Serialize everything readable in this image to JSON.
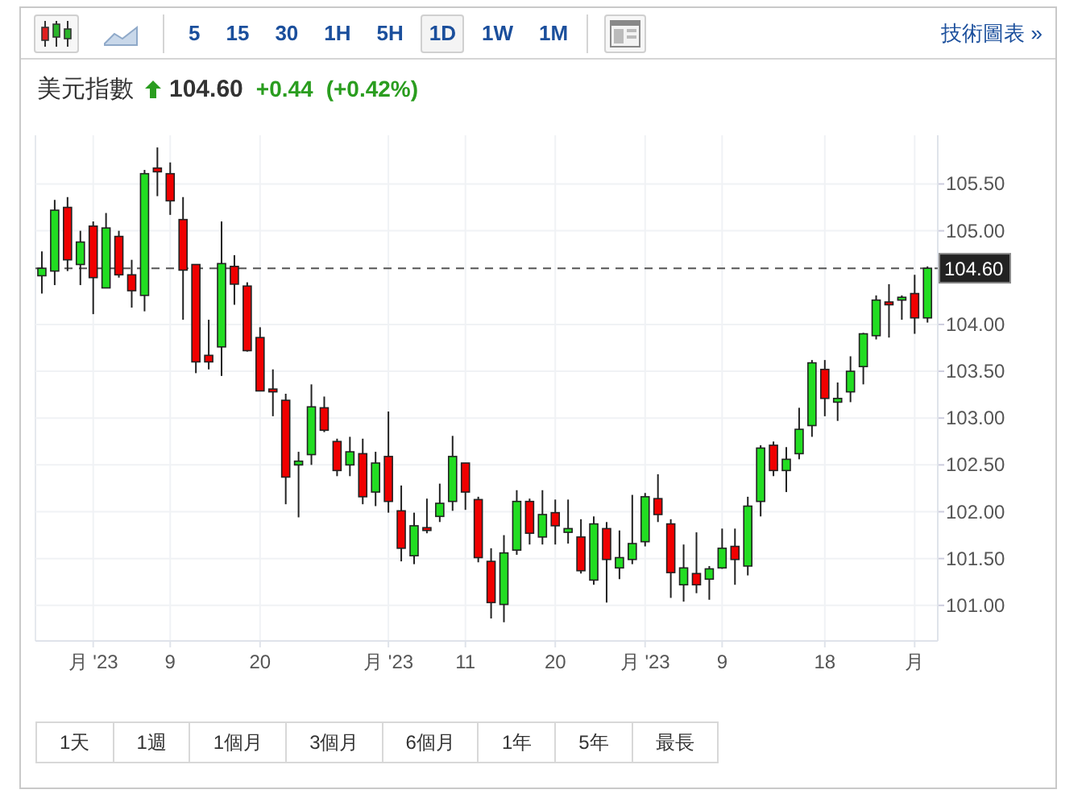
{
  "toolbar": {
    "chart_types": [
      {
        "kind": "candlestick",
        "selected": true
      },
      {
        "kind": "area",
        "selected": false
      }
    ],
    "intervals": [
      {
        "label": "5",
        "selected": false
      },
      {
        "label": "15",
        "selected": false
      },
      {
        "label": "30",
        "selected": false
      },
      {
        "label": "1H",
        "selected": false
      },
      {
        "label": "5H",
        "selected": false
      },
      {
        "label": "1D",
        "selected": true
      },
      {
        "label": "1W",
        "selected": false
      },
      {
        "label": "1M",
        "selected": false
      }
    ],
    "link": "技術圖表 »"
  },
  "quote": {
    "name": "美元指數",
    "up": true,
    "price": "104.60",
    "change": "+0.44",
    "change_percent": "(+0.42%)"
  },
  "chart": {
    "chart_data": {
      "type": "candlestick",
      "grid": true,
      "ylim": [
        100.62,
        106.02
      ],
      "yticks": [
        {
          "value": 105.5,
          "label": "105.50"
        },
        {
          "value": 105,
          "label": "105.00"
        },
        {
          "value": 104,
          "label": "104.00"
        },
        {
          "value": 103.5,
          "label": "103.50"
        },
        {
          "value": 103,
          "label": "103.00"
        },
        {
          "value": 102.5,
          "label": "102.50"
        },
        {
          "value": 102,
          "label": "102.00"
        },
        {
          "value": 101.5,
          "label": "101.50"
        },
        {
          "value": 101,
          "label": "101.00"
        }
      ],
      "categories": [
        null,
        null,
        null,
        null,
        "月 '23",
        null,
        null,
        null,
        null,
        null,
        "9",
        null,
        null,
        null,
        null,
        null,
        null,
        "20",
        null,
        null,
        null,
        null,
        null,
        null,
        null,
        null,
        null,
        "月 '23",
        null,
        null,
        null,
        null,
        null,
        "11",
        null,
        null,
        null,
        null,
        null,
        null,
        "20",
        null,
        null,
        null,
        null,
        null,
        null,
        "月 '23",
        null,
        null,
        null,
        null,
        null,
        "9",
        null,
        null,
        null,
        null,
        null,
        null,
        null,
        "18",
        null,
        null,
        null,
        null,
        null,
        null,
        "月",
        null
      ],
      "ohlc": [
        [
          104.52,
          104.78,
          104.33,
          104.6
        ],
        [
          104.57,
          105.33,
          104.42,
          105.22
        ],
        [
          105.25,
          105.36,
          104.57,
          104.69
        ],
        [
          104.64,
          105.0,
          104.42,
          104.88
        ],
        [
          105.05,
          105.1,
          104.11,
          104.5
        ],
        [
          104.39,
          105.19,
          104.39,
          105.03
        ],
        [
          104.94,
          105.0,
          104.5,
          104.53
        ],
        [
          104.53,
          104.69,
          104.18,
          104.36
        ],
        [
          104.31,
          105.65,
          104.14,
          105.61
        ],
        [
          105.67,
          105.89,
          105.37,
          105.63
        ],
        [
          105.61,
          105.73,
          105.17,
          105.32
        ],
        [
          105.12,
          105.36,
          104.05,
          104.58
        ],
        [
          104.64,
          104.64,
          103.48,
          103.6
        ],
        [
          103.67,
          104.05,
          103.52,
          103.6
        ],
        [
          103.76,
          105.1,
          103.45,
          104.65
        ],
        [
          104.62,
          104.74,
          104.21,
          104.43
        ],
        [
          104.41,
          104.45,
          103.71,
          103.72
        ],
        [
          103.86,
          103.97,
          103.29,
          103.29
        ],
        [
          103.31,
          103.52,
          103.02,
          103.28
        ],
        [
          103.19,
          103.26,
          102.08,
          102.37
        ],
        [
          102.5,
          102.64,
          101.94,
          102.54
        ],
        [
          102.61,
          103.36,
          102.5,
          103.12
        ],
        [
          103.11,
          103.23,
          102.85,
          102.87
        ],
        [
          102.75,
          102.78,
          102.38,
          102.44
        ],
        [
          102.5,
          102.8,
          102.38,
          102.64
        ],
        [
          102.62,
          102.78,
          102.08,
          102.16
        ],
        [
          102.21,
          102.64,
          102.06,
          102.52
        ],
        [
          102.59,
          103.07,
          101.99,
          102.11
        ],
        [
          102.01,
          102.28,
          101.47,
          101.61
        ],
        [
          101.53,
          101.99,
          101.44,
          101.85
        ],
        [
          101.83,
          102.14,
          101.77,
          101.8
        ],
        [
          101.95,
          102.3,
          101.89,
          102.09
        ],
        [
          102.11,
          102.81,
          102.01,
          102.59
        ],
        [
          102.52,
          102.52,
          102.02,
          102.21
        ],
        [
          102.13,
          102.16,
          101.46,
          101.51
        ],
        [
          101.47,
          101.61,
          100.86,
          101.03
        ],
        [
          101.01,
          101.75,
          100.82,
          101.56
        ],
        [
          101.59,
          102.23,
          101.54,
          102.11
        ],
        [
          102.11,
          102.14,
          101.65,
          101.77
        ],
        [
          101.73,
          102.23,
          101.65,
          101.97
        ],
        [
          101.99,
          102.13,
          101.65,
          101.85
        ],
        [
          101.78,
          102.13,
          101.66,
          101.82
        ],
        [
          101.73,
          101.92,
          101.34,
          101.37
        ],
        [
          101.27,
          101.95,
          101.22,
          101.87
        ],
        [
          101.82,
          101.89,
          101.03,
          101.49
        ],
        [
          101.4,
          101.8,
          101.28,
          101.51
        ],
        [
          101.49,
          102.18,
          101.44,
          101.66
        ],
        [
          101.68,
          102.2,
          101.63,
          102.16
        ],
        [
          102.14,
          102.4,
          101.89,
          101.97
        ],
        [
          101.87,
          101.92,
          101.08,
          101.35
        ],
        [
          101.22,
          101.65,
          101.04,
          101.4
        ],
        [
          101.34,
          101.78,
          101.13,
          101.22
        ],
        [
          101.28,
          101.42,
          101.06,
          101.39
        ],
        [
          101.4,
          101.82,
          101.39,
          101.61
        ],
        [
          101.63,
          101.82,
          101.22,
          101.49
        ],
        [
          101.42,
          102.16,
          101.32,
          102.06
        ],
        [
          102.11,
          102.71,
          101.95,
          102.68
        ],
        [
          102.71,
          102.75,
          102.38,
          102.44
        ],
        [
          102.44,
          102.69,
          102.21,
          102.56
        ],
        [
          102.62,
          103.11,
          102.56,
          102.88
        ],
        [
          102.92,
          103.62,
          102.8,
          103.59
        ],
        [
          103.52,
          103.62,
          103.02,
          103.21
        ],
        [
          103.17,
          103.38,
          102.97,
          103.21
        ],
        [
          103.28,
          103.66,
          103.17,
          103.5
        ],
        [
          103.55,
          103.91,
          103.36,
          103.9
        ],
        [
          103.88,
          104.31,
          103.84,
          104.26
        ],
        [
          104.24,
          104.43,
          103.86,
          104.21
        ],
        [
          104.26,
          104.31,
          104.05,
          104.29
        ],
        [
          104.33,
          104.53,
          103.9,
          104.07
        ],
        [
          104.07,
          104.62,
          104.02,
          104.6
        ]
      ],
      "ref_lines": [
        {
          "axis": "y",
          "value": 104.6,
          "label": "104.60"
        }
      ]
    }
  },
  "ranges": [
    {
      "label": "1天"
    },
    {
      "label": "1週"
    },
    {
      "label": "1個月"
    },
    {
      "label": "3個月"
    },
    {
      "label": "6個月"
    },
    {
      "label": "1年"
    },
    {
      "label": "5年"
    },
    {
      "label": "最長"
    }
  ]
}
